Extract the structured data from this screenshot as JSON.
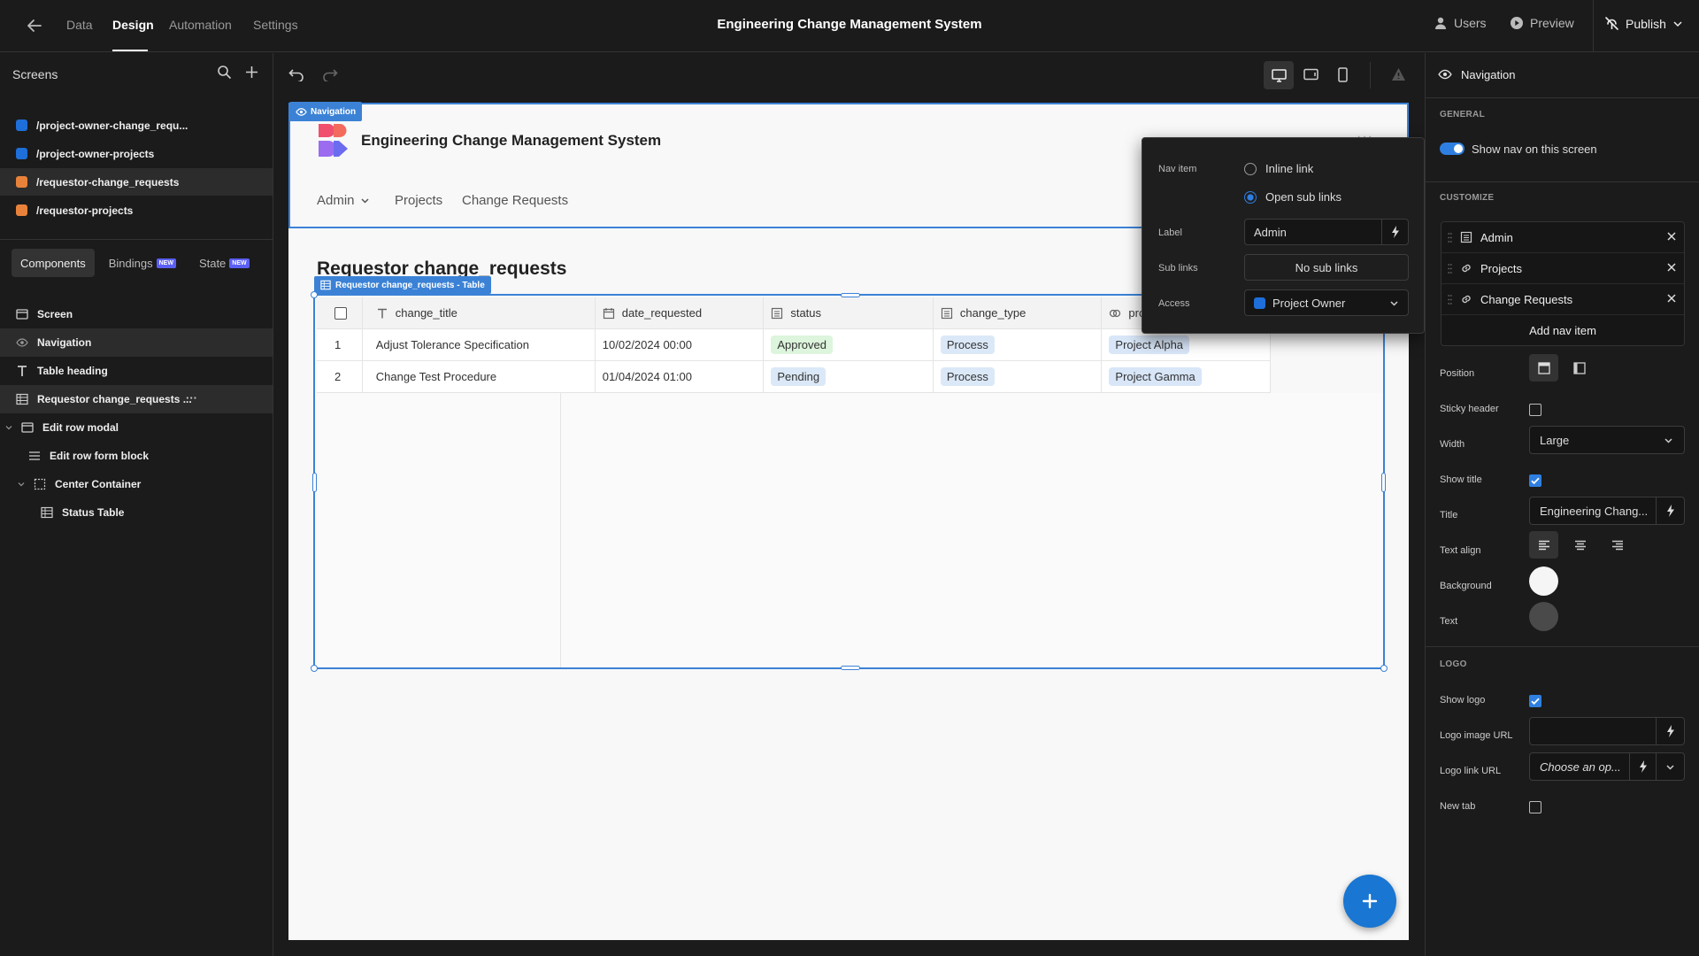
{
  "topbar": {
    "tabs": [
      "Data",
      "Design",
      "Automation",
      "Settings"
    ],
    "active_tab": "Design",
    "app_title": "Engineering Change Management System",
    "users_label": "Users",
    "preview_label": "Preview",
    "publish_label": "Publish"
  },
  "left": {
    "screens_title": "Screens",
    "screens": [
      {
        "path": "/project-owner-change_requ...",
        "color": "#1e6fd9"
      },
      {
        "path": "/project-owner-projects",
        "color": "#1e6fd9"
      },
      {
        "path": "/requestor-change_requests",
        "color": "#e8823a"
      },
      {
        "path": "/requestor-projects",
        "color": "#e8823a"
      }
    ],
    "tabs": {
      "components": "Components",
      "bindings": "Bindings",
      "state": "State",
      "new_badge": "NEW"
    },
    "components": [
      {
        "label": "Screen"
      },
      {
        "label": "Navigation"
      },
      {
        "label": "Table heading"
      },
      {
        "label": "Requestor change_requests ..."
      },
      {
        "label": "Edit row modal"
      },
      {
        "label": "Edit row form block"
      },
      {
        "label": "Center Container"
      },
      {
        "label": "Status Table"
      }
    ],
    "more_glyph": "···"
  },
  "canvas": {
    "nav_badge": "Navigation",
    "nav_title": "Engineering Change Management System",
    "nav_links": [
      "Admin",
      "Projects",
      "Change Requests"
    ],
    "nav_dots": "···",
    "page_heading": "Requestor change_requests",
    "table_badge": "Requestor change_requests - Table",
    "table": {
      "columns": [
        "change_title",
        "date_requested",
        "status",
        "change_type",
        "proje"
      ],
      "rows": [
        {
          "index": "1",
          "change_title": "Adjust Tolerance Specification",
          "date_requested": "10/02/2024 00:00",
          "status": "Approved",
          "change_type": "Process",
          "project": "Project Alpha"
        },
        {
          "index": "2",
          "change_title": "Change Test Procedure",
          "date_requested": "01/04/2024 01:00",
          "status": "Pending",
          "change_type": "Process",
          "project": "Project Gamma"
        }
      ]
    }
  },
  "popover": {
    "nav_item_label": "Nav item",
    "options": [
      "Inline link",
      "Open sub links"
    ],
    "selected_option": "Open sub links",
    "label_label": "Label",
    "label_value": "Admin",
    "sublinks_label": "Sub links",
    "sublinks_value": "No sub links",
    "access_label": "Access",
    "access_value": "Project Owner",
    "access_color": "#1e6fd9"
  },
  "right": {
    "header": "Navigation",
    "general_section": "GENERAL",
    "show_nav_label": "Show nav on this screen",
    "customize_section": "CUSTOMIZE",
    "nav_items": [
      "Admin",
      "Projects",
      "Change Requests"
    ],
    "add_nav_item": "Add nav item",
    "position_label": "Position",
    "sticky_label": "Sticky header",
    "width_label": "Width",
    "width_value": "Large",
    "show_title_label": "Show title",
    "title_label": "Title",
    "title_value": "Engineering Chang...",
    "text_align_label": "Text align",
    "background_label": "Background",
    "text_label": "Text",
    "background_color": "#f5f5f5",
    "text_color": "#4a4a4a",
    "logo_section": "LOGO",
    "show_logo_label": "Show logo",
    "logo_image_label": "Logo image URL",
    "logo_link_label": "Logo link URL",
    "logo_link_placeholder": "Choose an op...",
    "new_tab_label": "New tab"
  }
}
